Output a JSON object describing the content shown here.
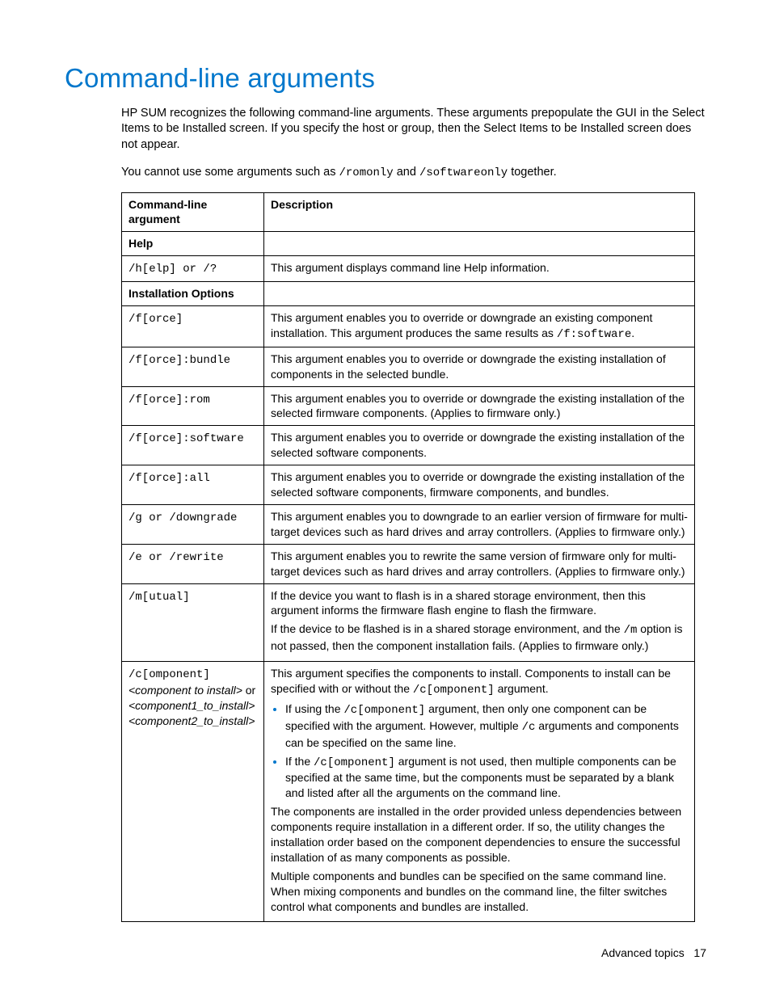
{
  "title": "Command-line arguments",
  "intro": "HP SUM recognizes the following command-line arguments. These arguments prepopulate the GUI in the Select Items to be Installed screen. If you specify the host or group, then the Select Items to be Installed screen does not appear.",
  "note_pre": "You cannot use some arguments such as ",
  "note_code1": "/romonly",
  "note_mid": " and ",
  "note_code2": "/softwareonly",
  "note_post": " together.",
  "headers": {
    "arg": "Command-line argument",
    "desc": "Description"
  },
  "sections": {
    "help": "Help",
    "install": "Installation Options"
  },
  "rows": {
    "help": {
      "arg": "/h[elp] or /?",
      "desc": "This argument displays command line Help information."
    },
    "force": {
      "arg": "/f[orce]",
      "desc_pre": "This argument enables you to override or downgrade an existing component installation. This argument produces the same results as ",
      "desc_code": "/f:software",
      "desc_post": "."
    },
    "force_bundle": {
      "arg": "/f[orce]:bundle",
      "desc": "This argument enables you to override or downgrade the existing installation of components in the selected bundle."
    },
    "force_rom": {
      "arg": "/f[orce]:rom",
      "desc": "This argument enables you to override or downgrade the existing installation of the selected firmware components. (Applies to firmware only.)"
    },
    "force_software": {
      "arg": "/f[orce]:software",
      "desc": "This argument enables you to override or downgrade the existing installation of the selected software components."
    },
    "force_all": {
      "arg": "/f[orce]:all",
      "desc": "This argument enables you to override or downgrade the existing installation of the selected software components, firmware components, and bundles."
    },
    "downgrade": {
      "arg": "/g or /downgrade",
      "desc": "This argument enables you to downgrade to an earlier version of firmware for multi-target devices such as hard drives and array controllers. (Applies to firmware only.)"
    },
    "rewrite": {
      "arg": "/e or /rewrite",
      "desc": "This argument enables you to rewrite the same version of firmware only for multi-target devices such as hard drives and array controllers. (Applies to firmware only.)"
    },
    "mutual": {
      "arg": "/m[utual]",
      "p1": "If the device you want to flash is in a shared storage environment, then this argument informs the firmware flash engine to flash the firmware.",
      "p2_pre": "If the device to be flashed is in a shared storage environment, and the ",
      "p2_code": "/m",
      "p2_post": " option is not passed, then the component installation fails. (Applies to firmware only.)"
    },
    "component": {
      "arg_code": "/c[omponent]",
      "arg_l2a": "<component to install>",
      "arg_l2b": " or",
      "arg_l3": "<component1_to_install>",
      "arg_l4": "<component2_to_install>",
      "p1_pre": "This argument specifies the components to install. Components to install can be specified with or without the ",
      "p1_code": "/c[omponent]",
      "p1_post": " argument.",
      "b1_pre": "If using the ",
      "b1_code": "/c[omponent]",
      "b1_mid": " argument, then only one component can be specified with the argument. However, multiple ",
      "b1_code2": "/c",
      "b1_post": " arguments and components can be specified on the same line.",
      "b2_pre": "If the ",
      "b2_code": "/c[omponent]",
      "b2_post": " argument is not used, then multiple components can be specified at the same time, but the components must be separated by a blank and listed after all the arguments on the command line.",
      "p2": "The components are installed in the order provided unless dependencies between components require installation in a different order. If so, the utility changes the installation order based on the component dependencies to ensure the successful installation of as many components as possible.",
      "p3": "Multiple components and bundles can be specified on the same command line. When mixing components and bundles on the command line, the filter switches control what components and bundles are installed."
    }
  },
  "footer": {
    "section": "Advanced topics",
    "page": "17"
  }
}
